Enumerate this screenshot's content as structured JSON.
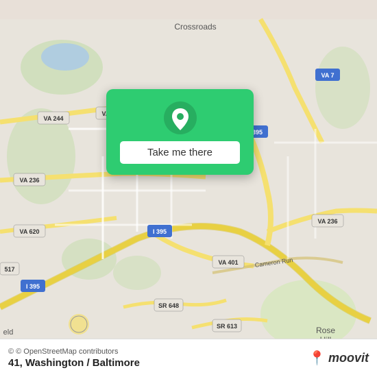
{
  "map": {
    "background_color": "#e8e4dc",
    "center_lat": 38.83,
    "center_lon": -77.09
  },
  "card": {
    "button_label": "Take me there",
    "background_color": "#2ecc71"
  },
  "bottom_bar": {
    "attribution_text": "© OpenStreetMap contributors",
    "location_label": "41, Washington / Baltimore",
    "logo_text": "moovit"
  }
}
